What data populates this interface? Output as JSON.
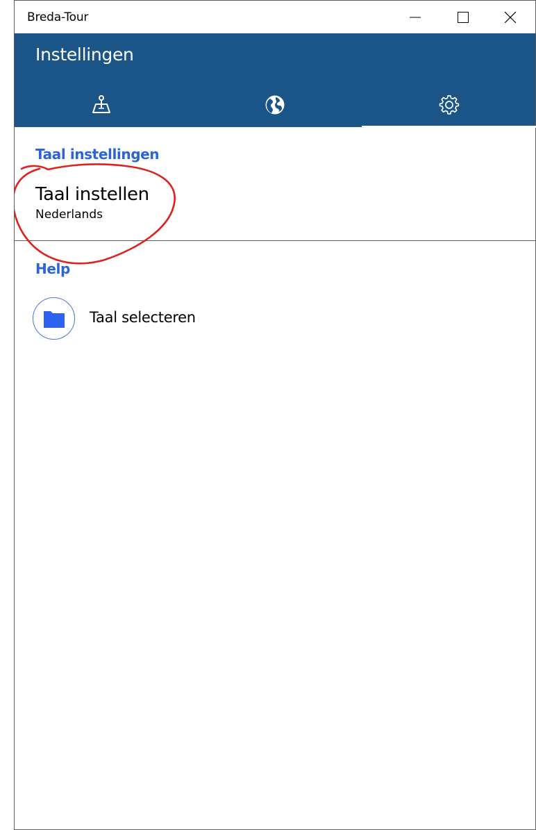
{
  "window": {
    "title": "Breda-Tour",
    "controls": {
      "minimize": "minimize-icon",
      "maximize": "maximize-icon",
      "close": "close-icon"
    }
  },
  "header": {
    "title": "Instellingen",
    "background": "#1b5487",
    "tabs": [
      {
        "icon": "map-pin-icon",
        "selected": false
      },
      {
        "icon": "globe-icon",
        "selected": false
      },
      {
        "icon": "gear-icon",
        "selected": true
      }
    ]
  },
  "sections": {
    "language": {
      "heading": "Taal instellingen",
      "item": {
        "title": "Taal instellen",
        "value": "Nederlands"
      }
    },
    "help": {
      "heading": "Help",
      "item": {
        "label": "Taal selecteren",
        "icon": "folder-icon"
      }
    }
  },
  "colors": {
    "accent": "#2b63d9",
    "annotation": "#e0201b"
  }
}
